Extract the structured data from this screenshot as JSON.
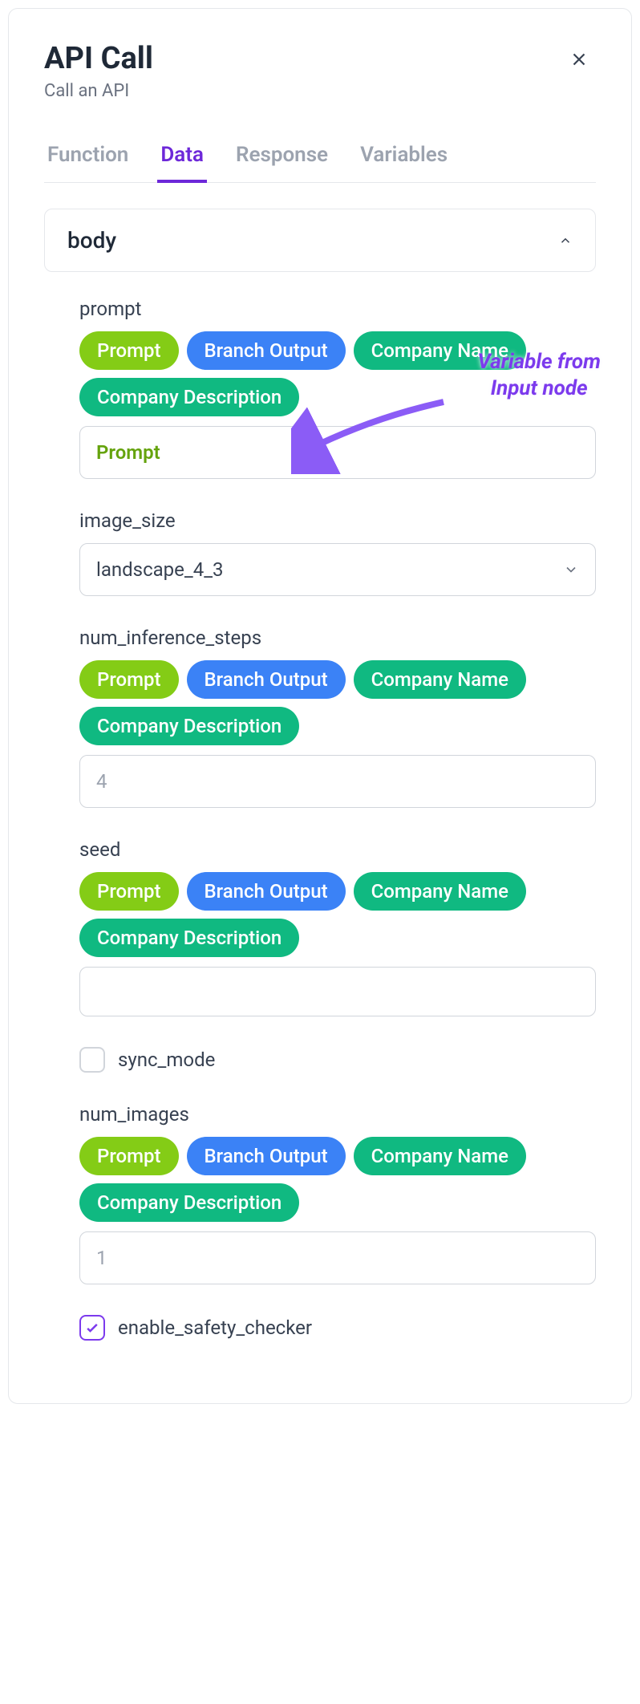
{
  "header": {
    "title": "API Call",
    "subtitle": "Call an API"
  },
  "tabs": [
    {
      "label": "Function",
      "active": false
    },
    {
      "label": "Data",
      "active": true
    },
    {
      "label": "Response",
      "active": false
    },
    {
      "label": "Variables",
      "active": false
    }
  ],
  "section": {
    "title": "body"
  },
  "pills": {
    "prompt": "Prompt",
    "branch_output": "Branch Output",
    "company_name": "Company Name",
    "company_description": "Company Description"
  },
  "fields": {
    "prompt": {
      "label": "prompt",
      "value": "Prompt"
    },
    "image_size": {
      "label": "image_size",
      "value": "landscape_4_3"
    },
    "num_inference_steps": {
      "label": "num_inference_steps",
      "value": "4"
    },
    "seed": {
      "label": "seed",
      "value": ""
    },
    "sync_mode": {
      "label": "sync_mode",
      "checked": false
    },
    "num_images": {
      "label": "num_images",
      "value": "1"
    },
    "enable_safety_checker": {
      "label": "enable_safety_checker",
      "checked": true
    }
  },
  "annotation": {
    "line1": "Variable from",
    "line2": "Input node"
  }
}
